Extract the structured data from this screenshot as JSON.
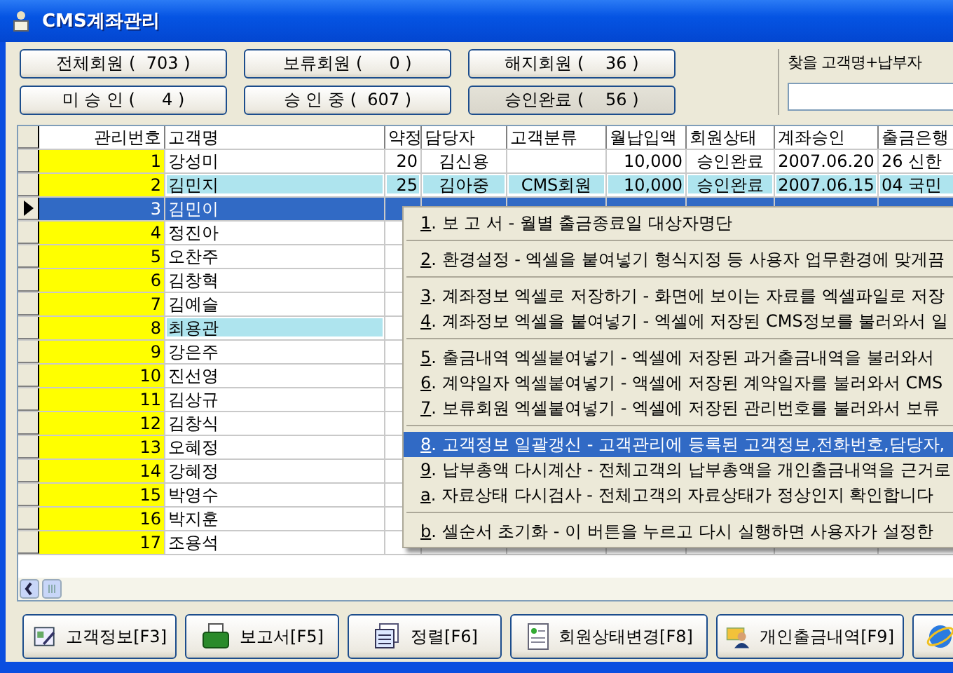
{
  "window": {
    "title": "CMS계좌관리"
  },
  "filters": [
    {
      "label": "전체회원 (  703 )",
      "selected": false
    },
    {
      "label": "보류회원 (     0 )",
      "selected": false
    },
    {
      "label": "해지회원 (    36 )",
      "selected": false
    },
    {
      "label": "미 승 인 (     4 )",
      "selected": false
    },
    {
      "label": "승 인 중 (  607 )",
      "selected": false
    },
    {
      "label": "승인완료 (    56 )",
      "selected": true
    }
  ],
  "search": {
    "label": "찾을 고객명+납부자"
  },
  "table": {
    "columns": [
      "관리번호",
      "고객명",
      "약정",
      "담당자",
      "고객분류",
      "월납입액",
      "회원상태",
      "계좌승인",
      "출금은행"
    ],
    "rows": [
      {
        "selected": false,
        "highlighted": false,
        "values": {
          "no": "1",
          "name": "강성미",
          "term": "20",
          "manager": "김신용",
          "amount": "10,000",
          "status": "승인완료",
          "approved": "2007.06.20",
          "bank": "26 신한"
        }
      },
      {
        "selected": false,
        "highlighted": true,
        "values": {
          "no": "2",
          "name": "김민지",
          "term": "25",
          "manager": "김아중",
          "category": "CMS회원",
          "amount": "10,000",
          "status": "승인완료",
          "approved": "2007.06.15",
          "bank": "04 국민"
        }
      },
      {
        "selected": true,
        "highlighted": false,
        "values": {
          "no": "3",
          "name": "김민이"
        }
      },
      {
        "selected": false,
        "highlighted": false,
        "values": {
          "no": "4",
          "name": "정진아"
        }
      },
      {
        "selected": false,
        "highlighted": false,
        "values": {
          "no": "5",
          "name": "오찬주"
        }
      },
      {
        "selected": false,
        "highlighted": false,
        "values": {
          "no": "6",
          "name": "김창혁"
        }
      },
      {
        "selected": false,
        "highlighted": false,
        "values": {
          "no": "7",
          "name": "김예슬"
        }
      },
      {
        "selected": false,
        "highlighted": true,
        "values": {
          "no": "8",
          "name": "최용관"
        }
      },
      {
        "selected": false,
        "highlighted": false,
        "values": {
          "no": "9",
          "name": "강은주"
        }
      },
      {
        "selected": false,
        "highlighted": false,
        "values": {
          "no": "10",
          "name": "진선영"
        }
      },
      {
        "selected": false,
        "highlighted": false,
        "values": {
          "no": "11",
          "name": "김상규"
        }
      },
      {
        "selected": false,
        "highlighted": false,
        "values": {
          "no": "12",
          "name": "김창식"
        }
      },
      {
        "selected": false,
        "highlighted": false,
        "values": {
          "no": "13",
          "name": "오혜정"
        }
      },
      {
        "selected": false,
        "highlighted": false,
        "values": {
          "no": "14",
          "name": "강혜정"
        }
      },
      {
        "selected": false,
        "highlighted": false,
        "values": {
          "no": "15",
          "name": "박영수"
        }
      },
      {
        "selected": false,
        "highlighted": false,
        "values": {
          "no": "16",
          "name": "박지훈"
        }
      },
      {
        "selected": false,
        "highlighted": false,
        "values": {
          "no": "17",
          "name": "조용석"
        }
      }
    ]
  },
  "context_menu": [
    {
      "kind": "item",
      "key": "1",
      "text": ". 보 고 서 - 월별 출금종료일 대상자명단",
      "selected": false
    },
    {
      "kind": "separator"
    },
    {
      "kind": "item",
      "key": "2",
      "text": ". 환경설정 - 엑셀을 붙여넣기 형식지정 등 사용자 업무환경에 맞게끔",
      "selected": false
    },
    {
      "kind": "separator"
    },
    {
      "kind": "item",
      "key": "3",
      "text": ". 계좌정보 엑셀로 저장하기 - 화면에 보이는 자료를 엑셀파일로 저장",
      "selected": false
    },
    {
      "kind": "item",
      "key": "4",
      "text": ". 계좌정보 엑셀을 붙여넣기 - 엑셀에 저장된 CMS정보를 불러와서 일",
      "selected": false
    },
    {
      "kind": "separator"
    },
    {
      "kind": "item",
      "key": "5",
      "text": ". 출금내역 엑셀붙여넣기 - 엑셀에 저장된 과거출금내역을 불러와서",
      "selected": false
    },
    {
      "kind": "item",
      "key": "6",
      "text": ". 계약일자 엑셀붙여넣기 - 액셀에 저장된 계약일자를 불러와서 CMS",
      "selected": false
    },
    {
      "kind": "item",
      "key": "7",
      "text": ". 보류회원 엑셀붙여넣기 - 엑셀에 저장된 관리번호를 불러와서 보류",
      "selected": false
    },
    {
      "kind": "separator"
    },
    {
      "kind": "item",
      "key": "8",
      "text": ". 고객정보 일괄갱신 - 고객관리에 등록된 고객정보,전화번호,담당자,",
      "selected": true
    },
    {
      "kind": "item",
      "key": "9",
      "text": ". 납부총액 다시계산 - 전체고객의 납부총액을 개인출금내역을 근거로",
      "selected": false
    },
    {
      "kind": "item",
      "key": "a",
      "text": ". 자료상태 다시검사 - 전체고객의 자료상태가 정상인지 확인합니다",
      "selected": false
    },
    {
      "kind": "separator"
    },
    {
      "kind": "item",
      "key": "b",
      "text": ". 셀순서 초기화 - 이 버튼을 누르고 다시 실행하면 사용자가 설정한",
      "selected": false
    }
  ],
  "toolbar": [
    {
      "kind": "labeled",
      "label": "고객정보[F3]"
    },
    {
      "kind": "labeled",
      "label": "보고서[F5]"
    },
    {
      "kind": "labeled",
      "label": "정렬[F6]"
    },
    {
      "kind": "labeled",
      "label": "회원상태변경[F8]"
    },
    {
      "kind": "labeled",
      "label": "개인출금내역[F9]"
    },
    {
      "kind": "icon"
    }
  ]
}
